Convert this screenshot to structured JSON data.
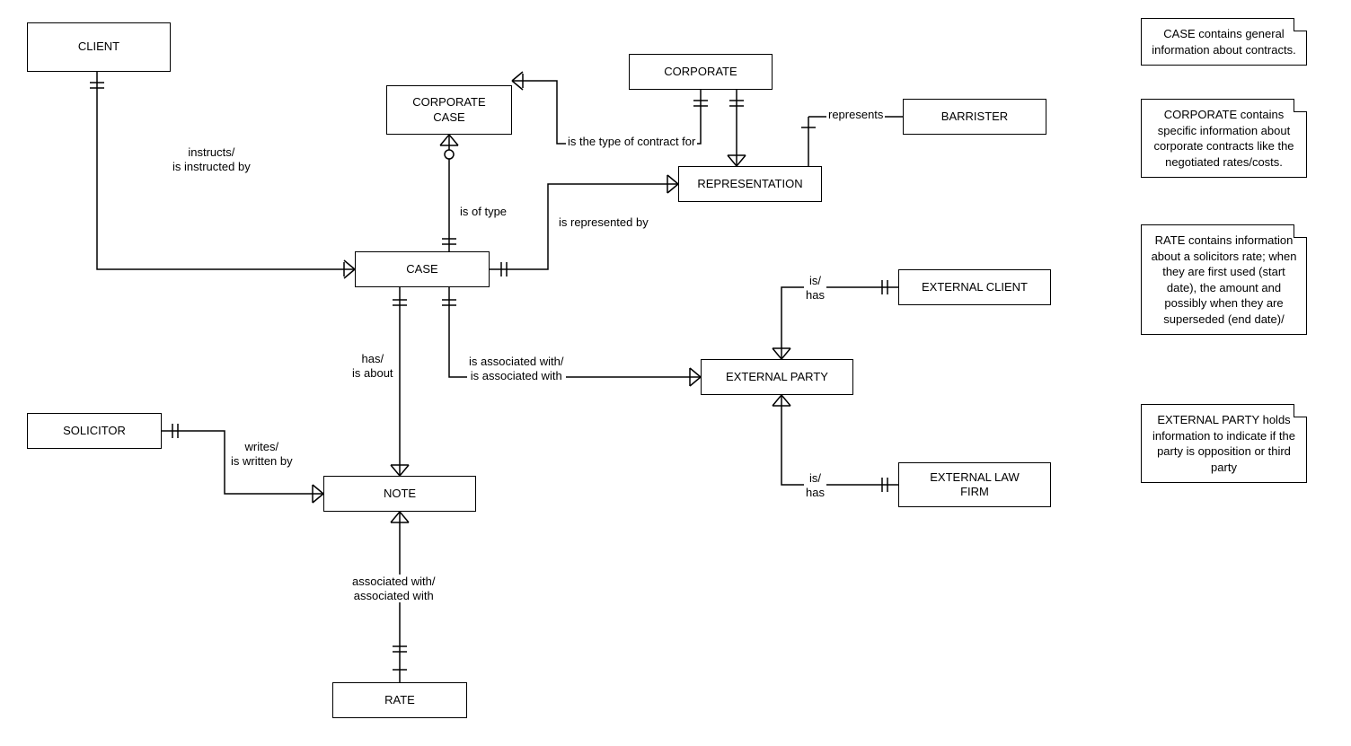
{
  "entities": {
    "client": "CLIENT",
    "corporate_case": "CORPORATE\nCASE",
    "corporate": "CORPORATE",
    "barrister": "BARRISTER",
    "representation": "REPRESENTATION",
    "case": "CASE",
    "external_client": "EXTERNAL CLIENT",
    "external_party": "EXTERNAL PARTY",
    "external_law_firm": "EXTERNAL LAW\nFIRM",
    "solicitor": "SOLICITOR",
    "note": "NOTE",
    "rate": "RATE"
  },
  "relationships": {
    "instructs": "instructs/\nis instructed by",
    "is_of_type": "is of type",
    "is_type_of_contract": "is the type of contract for",
    "represents": "represents",
    "is_represented_by": "is represented by",
    "has_is_about": "has/\nis about",
    "is_associated_with": "is associated with/\nis associated with",
    "is_has_ec": "is/\nhas",
    "is_has_elf": "is/\nhas",
    "writes": "writes/\nis written by",
    "associated_with": "associated with/\nassociated with"
  },
  "notes": {
    "case_note": "CASE contains general information about contracts.",
    "corporate_note": "CORPORATE contains specific information about corporate contracts like the negotiated rates/costs.",
    "rate_note": "RATE contains information about a solicitors rate; when they are first used (start date), the amount and possibly when they are superseded (end date)/",
    "external_party_note": "EXTERNAL PARTY holds information to indicate if the party is opposition or third party"
  }
}
